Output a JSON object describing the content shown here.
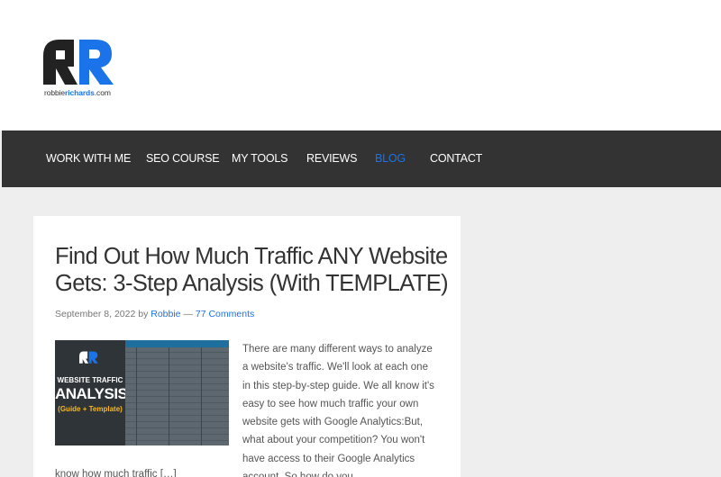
{
  "site": {
    "logo_icon": "rr-logo",
    "logo_text_pre": "robbie",
    "logo_text_bold": "richards",
    "logo_text_post": ".com",
    "accent_color": "#1a73e8"
  },
  "nav": {
    "items": [
      {
        "label": "WORK WITH ME"
      },
      {
        "label": "SEO COURSE"
      },
      {
        "label": "MY TOOLS"
      },
      {
        "label": "REVIEWS"
      },
      {
        "label": "BLOG",
        "active": true
      },
      {
        "label": "CONTACT"
      }
    ]
  },
  "post": {
    "title": "Find Out How Much Traffic ANY Website Gets: 3-Step Analysis (With TEMPLATE)",
    "date": "September 8, 2022",
    "by": "by",
    "author": "Robbie",
    "separator": "—",
    "comments": "77 Comments",
    "thumbnail": {
      "line1": "WEBSITE TRAFFIC",
      "line2": "ANALYSIS",
      "line3": "(Guide + Template)"
    },
    "excerpt": "There are many different ways to analyze a website's traffic. We'll look at each one in this step-by-step guide. We all know it's easy to see how much traffic your own website gets with Google Analytics:But, what about your competition? You won't have access to their Google Analytics account. So how do you",
    "excerpt_tail": "know how much traffic […]"
  }
}
